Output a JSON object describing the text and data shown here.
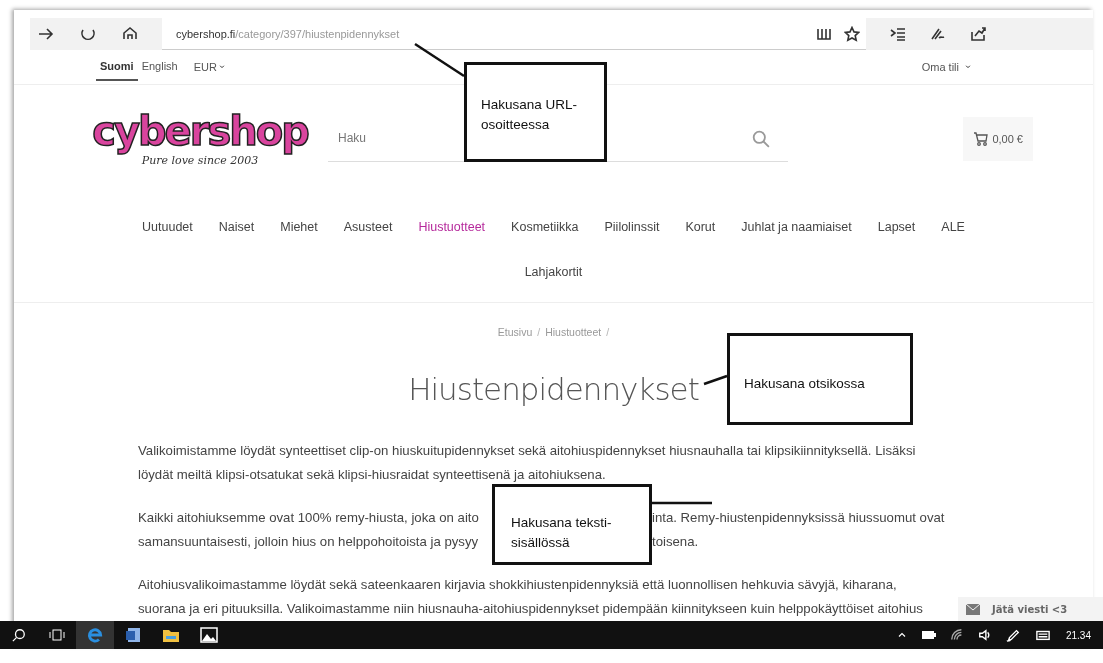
{
  "browser": {
    "url_host": "cybershop.fi",
    "url_path": "/category/397/hiustenpidennykset"
  },
  "top_bar": {
    "languages": [
      {
        "label": "Suomi",
        "selected": true
      },
      {
        "label": "English",
        "selected": false
      }
    ],
    "currency": "EUR",
    "account": "Oma tili"
  },
  "header": {
    "logo": {
      "name": "cybershop",
      "tagline": "Pure love since 2003"
    },
    "search": {
      "placeholder": "Haku"
    },
    "cart": "0,00 €"
  },
  "nav": {
    "items": [
      {
        "label": "Uutuudet",
        "selected": false
      },
      {
        "label": "Naiset",
        "selected": false
      },
      {
        "label": "Miehet",
        "selected": false
      },
      {
        "label": "Asusteet",
        "selected": false
      },
      {
        "label": "Hiustuotteet",
        "selected": true
      },
      {
        "label": "Kosmetiikka",
        "selected": false
      },
      {
        "label": "Piilolinssit",
        "selected": false
      },
      {
        "label": "Korut",
        "selected": false
      },
      {
        "label": "Juhlat ja naamiaiset",
        "selected": false
      },
      {
        "label": "Lapset",
        "selected": false
      },
      {
        "label": "ALE",
        "selected": false
      },
      {
        "label": "Lahjakortit",
        "selected": false
      }
    ]
  },
  "breadcrumb": [
    {
      "kind": "link",
      "text": "Etusivu"
    },
    {
      "kind": "separator",
      "text": "/"
    },
    {
      "kind": "link",
      "text": "Hiustuotteet"
    },
    {
      "kind": "separator",
      "text": "/"
    }
  ],
  "title": "Hiustenpidennykset",
  "paragraphs": [
    {
      "lines": [
        [
          "Valikoimistamme löydät synteettiset clip-on hiuskuitupidennykset sekä aitohiuspidennykset hiusnauhalla tai klipsikiinnityksellä. Lisäksi"
        ],
        [
          "löydät meiltä klipsi-otsatukat sekä klipsi-hiusraidat synteettisenä ja aitohiuksena."
        ]
      ]
    },
    {
      "lines": [
        [
          "Kaikki aitohiuksemme ovat 100% remy-hiusta, joka on aito",
          "inta. Remy-hiustenpidennyksissä hiussuomut ovat"
        ],
        [
          "samansuuntaisesti, jolloin hius on helppohoitoista ja pysyy",
          "toisena."
        ]
      ]
    },
    {
      "lines": [
        [
          "Aitohiusvalikoimastamme löydät sekä sateenkaaren kirjavia shokkihiustenpidennyksiä että luonnollisen hehkuvia sävyjä, kiharana,"
        ],
        [
          "suorana ja eri pituuksilla. Valikoimastamme niin hiusnauha-aitohiuspidennykset pidempään kiinnitykseen kuin helppokäyttöiset aitohius"
        ]
      ]
    }
  ],
  "annotations": [
    {
      "text": "Hakusana URL-osoitteessa"
    },
    {
      "text": "Hakusana otsikossa"
    },
    {
      "text": "Hakusana teksti-sisällössä"
    }
  ],
  "chat": {
    "label": "Jätä viesti <3"
  },
  "taskbar": {
    "time": "21.34"
  }
}
